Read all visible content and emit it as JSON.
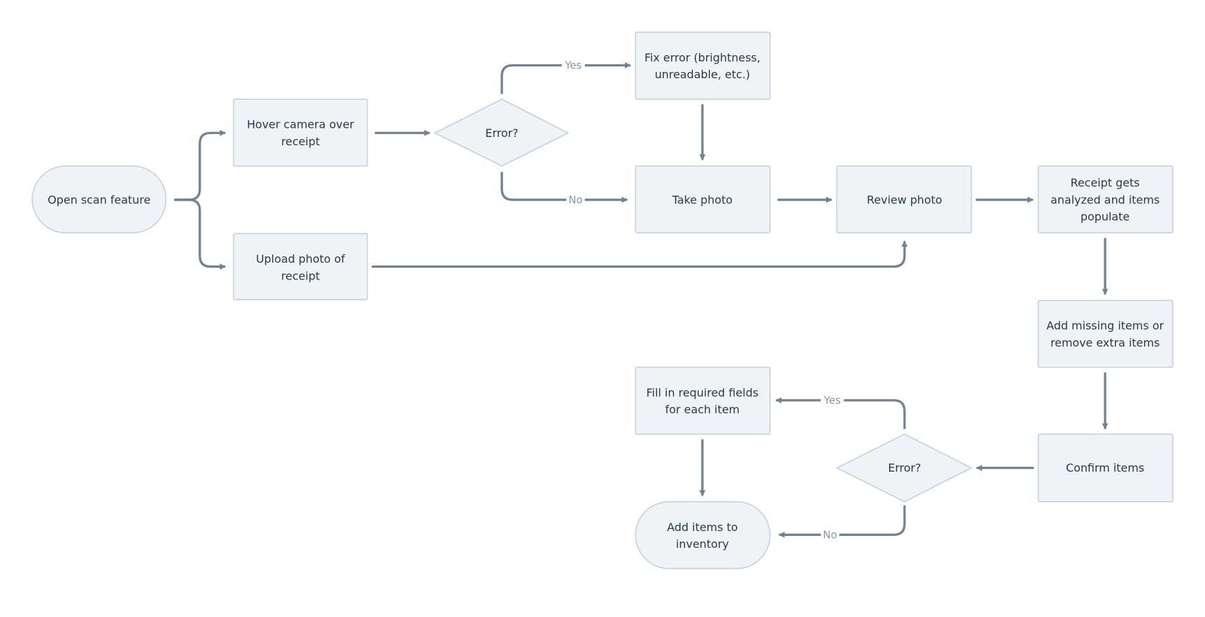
{
  "nodes": {
    "open_scan": [
      "Open scan feature"
    ],
    "hover": [
      "Hover camera over",
      "receipt"
    ],
    "upload": [
      "Upload photo of",
      "receipt"
    ],
    "error1": [
      "Error?"
    ],
    "fix_error": [
      "Fix error (brightness,",
      "unreadable, etc.)"
    ],
    "take_photo": [
      "Take photo"
    ],
    "review": [
      "Review photo"
    ],
    "analyzed": [
      "Receipt gets",
      "analyzed and items",
      "populate"
    ],
    "add_missing": [
      "Add missing items or",
      "remove extra items"
    ],
    "confirm": [
      "Confirm items"
    ],
    "error2": [
      "Error?"
    ],
    "fill_fields": [
      "Fill in required fields",
      "for each item"
    ],
    "add_inventory": [
      "Add items to",
      "inventory"
    ]
  },
  "edge_labels": {
    "e1_yes": "Yes",
    "e1_no": "No",
    "e2_yes": "Yes",
    "e2_no": "No"
  },
  "colors": {
    "node_fill": "#eff3f6",
    "node_stroke": "#c5d2dc",
    "edge": "#728291",
    "text": "#2b3947"
  }
}
